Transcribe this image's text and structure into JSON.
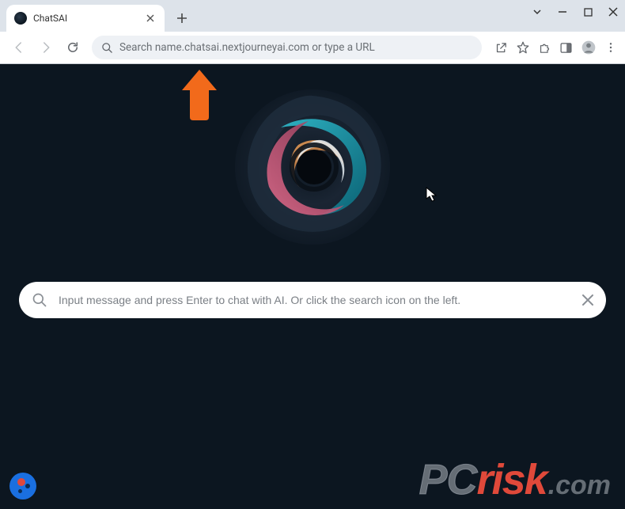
{
  "titlebar": {
    "tab_title": "ChatSAI"
  },
  "omnibox": {
    "text": "Search name.chatsai.nextjourneyai.com or type a URL"
  },
  "page_search": {
    "placeholder": "Input message and press Enter to chat with AI. Or click the search icon on the left.",
    "value": ""
  },
  "watermark": {
    "pc": "PC",
    "risk": "risk",
    "com": ".com"
  },
  "icons": {
    "back": "back-icon",
    "forward": "forward-icon",
    "reload": "reload-icon",
    "search": "search-icon",
    "share": "share-icon",
    "bookmark": "star-icon",
    "extensions": "puzzle-icon",
    "side_panel": "side-panel-icon",
    "profile": "profile-icon",
    "menu": "kebab-icon",
    "close": "close-icon",
    "new_tab": "plus-icon",
    "chevron": "chevron-down-icon",
    "minimize": "minimize-icon",
    "maximize": "maximize-icon",
    "window_close": "window-close-icon",
    "clear": "clear-icon"
  },
  "colors": {
    "page_bg": "#0c1620",
    "accent_orange": "#f26a1b",
    "risk_red": "#e0493a",
    "badge_blue": "#1a6fe0"
  }
}
